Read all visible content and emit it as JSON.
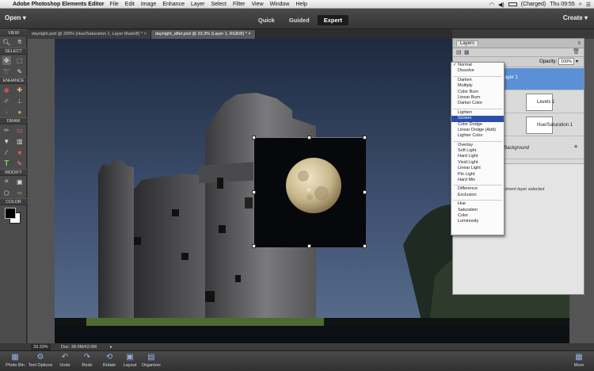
{
  "menubar": {
    "app": "Adobe Photoshop Elements Editor",
    "items": [
      "File",
      "Edit",
      "Image",
      "Enhance",
      "Layer",
      "Select",
      "Filter",
      "View",
      "Window",
      "Help"
    ],
    "battery": "(Charged)",
    "clock": "Thu 09:55"
  },
  "header": {
    "open": "Open",
    "modes": [
      "Quick",
      "Guided",
      "Expert"
    ],
    "active_mode": "Expert",
    "create": "Create"
  },
  "toolbox": {
    "sections": [
      "VIEW",
      "SELECT",
      "ENHANCE",
      "DRAW",
      "MODIFY",
      "COLOR"
    ]
  },
  "doc_tabs": [
    "daynight.psd @ 200% (Hue/Saturation 1, Layer Mask/8) *",
    "daynight_after.psd @ 33.3% (Layer 1, RGB/8) *"
  ],
  "layers": {
    "title": "Layers",
    "opacity_label": "Opacity:",
    "opacity_value": "100%",
    "rows": [
      "Layer 1",
      "Levels 1",
      "Hue/Saturation 1",
      "Background"
    ],
    "hint": "tment layer selected"
  },
  "blend_modes": [
    [
      "Normal",
      "Dissolve"
    ],
    [
      "Darken",
      "Multiply",
      "Color Burn",
      "Linear Burn",
      "Darker Color"
    ],
    [
      "Lighten",
      "Screen",
      "Color Dodge",
      "Linear Dodge (Add)",
      "Lighter Color"
    ],
    [
      "Overlay",
      "Soft Light",
      "Hard Light",
      "Vivid Light",
      "Linear Light",
      "Pin Light",
      "Hard Mix"
    ],
    [
      "Difference",
      "Exclusion"
    ],
    [
      "Hue",
      "Saturation",
      "Color",
      "Luminosity"
    ]
  ],
  "blend_selected": "Normal",
  "blend_highlight": "Screen",
  "status": {
    "zoom": "33.33%",
    "doc": "Doc: 38.0M/42.0M"
  },
  "bottombar": {
    "items": [
      "Photo Bin",
      "Tool Options",
      "Undo",
      "Redo",
      "Rotate",
      "Layout",
      "Organizer"
    ],
    "more": "More"
  }
}
